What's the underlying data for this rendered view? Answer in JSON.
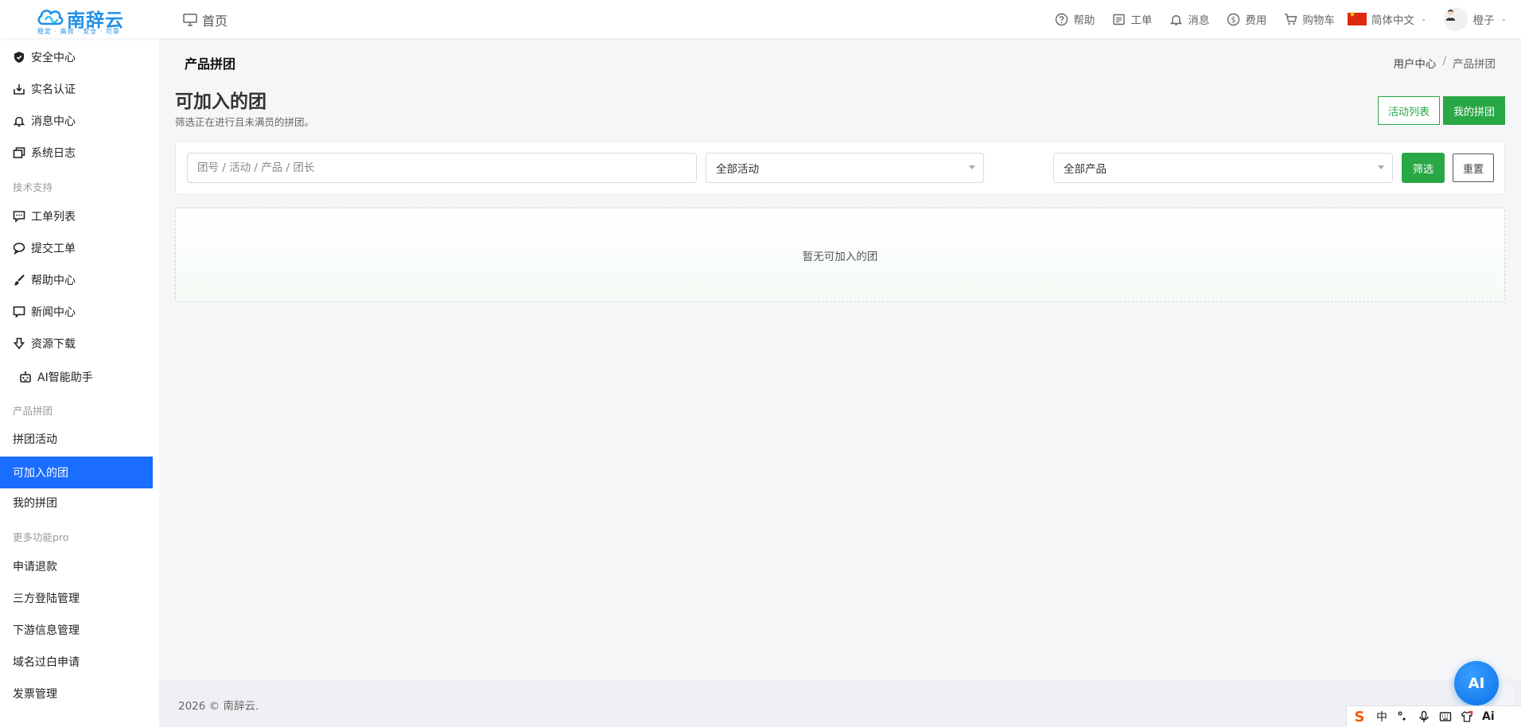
{
  "brand": {
    "name": "南辞云",
    "tagline": "稳定 · 高效 · 安全 · 可靠",
    "color": "#1f8fe8"
  },
  "topnav": {
    "home": "首页",
    "items": [
      {
        "icon": "help-icon",
        "label": "帮助"
      },
      {
        "icon": "ticket-icon",
        "label": "工单"
      },
      {
        "icon": "bell-icon",
        "label": "消息"
      },
      {
        "icon": "dollar-icon",
        "label": "费用"
      },
      {
        "icon": "cart-icon",
        "label": "购物车"
      }
    ],
    "language": "简体中文",
    "user": "橙子"
  },
  "sidebar": {
    "items": [
      {
        "icon": "shield-icon",
        "label": "安全中心"
      },
      {
        "icon": "id-card-icon",
        "label": "实名认证"
      },
      {
        "icon": "bell-icon",
        "label": "消息中心"
      },
      {
        "icon": "log-icon",
        "label": "系统日志"
      }
    ],
    "group_support": "技术支持",
    "support_items": [
      {
        "icon": "chat-icon",
        "label": "工单列表"
      },
      {
        "icon": "comment-icon",
        "label": "提交工单"
      },
      {
        "icon": "brush-icon",
        "label": "帮助中心"
      },
      {
        "icon": "news-icon",
        "label": "新闻中心"
      },
      {
        "icon": "download-icon",
        "label": "资源下载"
      },
      {
        "icon": "robot-icon",
        "label": "AI智能助手"
      }
    ],
    "group_group_buy": "产品拼团",
    "group_buy_items": [
      {
        "label": "拼团活动"
      },
      {
        "label": "可加入的团",
        "active": true
      },
      {
        "label": "我的拼团"
      }
    ],
    "group_more": "更多功能pro",
    "more_items": [
      {
        "label": "申请退款"
      },
      {
        "label": "三方登陆管理"
      },
      {
        "label": "下游信息管理"
      },
      {
        "label": "域名过白申请"
      },
      {
        "label": "发票管理"
      }
    ]
  },
  "page": {
    "section_title": "产品拼团",
    "breadcrumb": [
      "用户中心",
      "产品拼团"
    ],
    "heading": "可加入的团",
    "subheading": "筛选正在进行且未满员的拼团。",
    "btn_activity_list": "活动列表",
    "btn_my_groups": "我的拼团"
  },
  "filter": {
    "search_placeholder": "团号 / 活动 / 产品 / 团长",
    "activity_select": "全部活动",
    "product_select": "全部产品",
    "btn_filter": "筛选",
    "btn_reset": "重置"
  },
  "empty_text": "暂无可加入的团",
  "footer": "2026 © 南辞云.",
  "ai_button": "AI",
  "ime": {
    "mode": "中",
    "ai_label": "Ai"
  },
  "colors": {
    "accent_blue": "#1a6dff",
    "accent_green": "#28a745"
  }
}
